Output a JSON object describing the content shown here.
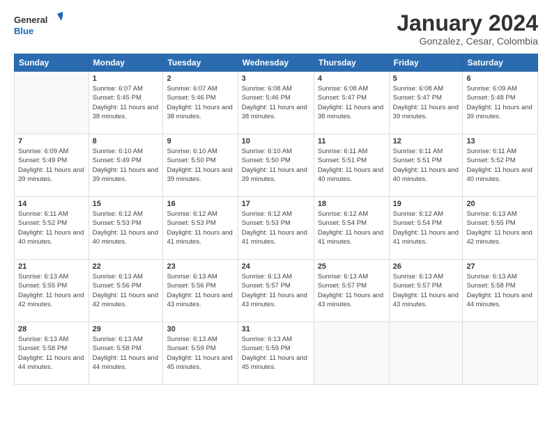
{
  "header": {
    "logo_line1": "General",
    "logo_line2": "Blue",
    "main_title": "January 2024",
    "subtitle": "Gonzalez, Cesar, Colombia"
  },
  "days_of_week": [
    "Sunday",
    "Monday",
    "Tuesday",
    "Wednesday",
    "Thursday",
    "Friday",
    "Saturday"
  ],
  "weeks": [
    [
      {
        "num": "",
        "sunrise": "",
        "sunset": "",
        "daylight": ""
      },
      {
        "num": "1",
        "sunrise": "Sunrise: 6:07 AM",
        "sunset": "Sunset: 5:45 PM",
        "daylight": "Daylight: 11 hours and 38 minutes."
      },
      {
        "num": "2",
        "sunrise": "Sunrise: 6:07 AM",
        "sunset": "Sunset: 5:46 PM",
        "daylight": "Daylight: 11 hours and 38 minutes."
      },
      {
        "num": "3",
        "sunrise": "Sunrise: 6:08 AM",
        "sunset": "Sunset: 5:46 PM",
        "daylight": "Daylight: 11 hours and 38 minutes."
      },
      {
        "num": "4",
        "sunrise": "Sunrise: 6:08 AM",
        "sunset": "Sunset: 5:47 PM",
        "daylight": "Daylight: 11 hours and 38 minutes."
      },
      {
        "num": "5",
        "sunrise": "Sunrise: 6:08 AM",
        "sunset": "Sunset: 5:47 PM",
        "daylight": "Daylight: 11 hours and 39 minutes."
      },
      {
        "num": "6",
        "sunrise": "Sunrise: 6:09 AM",
        "sunset": "Sunset: 5:48 PM",
        "daylight": "Daylight: 11 hours and 39 minutes."
      }
    ],
    [
      {
        "num": "7",
        "sunrise": "Sunrise: 6:09 AM",
        "sunset": "Sunset: 5:49 PM",
        "daylight": "Daylight: 11 hours and 39 minutes."
      },
      {
        "num": "8",
        "sunrise": "Sunrise: 6:10 AM",
        "sunset": "Sunset: 5:49 PM",
        "daylight": "Daylight: 11 hours and 39 minutes."
      },
      {
        "num": "9",
        "sunrise": "Sunrise: 6:10 AM",
        "sunset": "Sunset: 5:50 PM",
        "daylight": "Daylight: 11 hours and 39 minutes."
      },
      {
        "num": "10",
        "sunrise": "Sunrise: 6:10 AM",
        "sunset": "Sunset: 5:50 PM",
        "daylight": "Daylight: 11 hours and 39 minutes."
      },
      {
        "num": "11",
        "sunrise": "Sunrise: 6:11 AM",
        "sunset": "Sunset: 5:51 PM",
        "daylight": "Daylight: 11 hours and 40 minutes."
      },
      {
        "num": "12",
        "sunrise": "Sunrise: 6:11 AM",
        "sunset": "Sunset: 5:51 PM",
        "daylight": "Daylight: 11 hours and 40 minutes."
      },
      {
        "num": "13",
        "sunrise": "Sunrise: 6:11 AM",
        "sunset": "Sunset: 5:52 PM",
        "daylight": "Daylight: 11 hours and 40 minutes."
      }
    ],
    [
      {
        "num": "14",
        "sunrise": "Sunrise: 6:11 AM",
        "sunset": "Sunset: 5:52 PM",
        "daylight": "Daylight: 11 hours and 40 minutes."
      },
      {
        "num": "15",
        "sunrise": "Sunrise: 6:12 AM",
        "sunset": "Sunset: 5:53 PM",
        "daylight": "Daylight: 11 hours and 40 minutes."
      },
      {
        "num": "16",
        "sunrise": "Sunrise: 6:12 AM",
        "sunset": "Sunset: 5:53 PM",
        "daylight": "Daylight: 11 hours and 41 minutes."
      },
      {
        "num": "17",
        "sunrise": "Sunrise: 6:12 AM",
        "sunset": "Sunset: 5:53 PM",
        "daylight": "Daylight: 11 hours and 41 minutes."
      },
      {
        "num": "18",
        "sunrise": "Sunrise: 6:12 AM",
        "sunset": "Sunset: 5:54 PM",
        "daylight": "Daylight: 11 hours and 41 minutes."
      },
      {
        "num": "19",
        "sunrise": "Sunrise: 6:12 AM",
        "sunset": "Sunset: 5:54 PM",
        "daylight": "Daylight: 11 hours and 41 minutes."
      },
      {
        "num": "20",
        "sunrise": "Sunrise: 6:13 AM",
        "sunset": "Sunset: 5:55 PM",
        "daylight": "Daylight: 11 hours and 42 minutes."
      }
    ],
    [
      {
        "num": "21",
        "sunrise": "Sunrise: 6:13 AM",
        "sunset": "Sunset: 5:55 PM",
        "daylight": "Daylight: 11 hours and 42 minutes."
      },
      {
        "num": "22",
        "sunrise": "Sunrise: 6:13 AM",
        "sunset": "Sunset: 5:56 PM",
        "daylight": "Daylight: 11 hours and 42 minutes."
      },
      {
        "num": "23",
        "sunrise": "Sunrise: 6:13 AM",
        "sunset": "Sunset: 5:56 PM",
        "daylight": "Daylight: 11 hours and 43 minutes."
      },
      {
        "num": "24",
        "sunrise": "Sunrise: 6:13 AM",
        "sunset": "Sunset: 5:57 PM",
        "daylight": "Daylight: 11 hours and 43 minutes."
      },
      {
        "num": "25",
        "sunrise": "Sunrise: 6:13 AM",
        "sunset": "Sunset: 5:57 PM",
        "daylight": "Daylight: 11 hours and 43 minutes."
      },
      {
        "num": "26",
        "sunrise": "Sunrise: 6:13 AM",
        "sunset": "Sunset: 5:57 PM",
        "daylight": "Daylight: 11 hours and 43 minutes."
      },
      {
        "num": "27",
        "sunrise": "Sunrise: 6:13 AM",
        "sunset": "Sunset: 5:58 PM",
        "daylight": "Daylight: 11 hours and 44 minutes."
      }
    ],
    [
      {
        "num": "28",
        "sunrise": "Sunrise: 6:13 AM",
        "sunset": "Sunset: 5:58 PM",
        "daylight": "Daylight: 11 hours and 44 minutes."
      },
      {
        "num": "29",
        "sunrise": "Sunrise: 6:13 AM",
        "sunset": "Sunset: 5:58 PM",
        "daylight": "Daylight: 11 hours and 44 minutes."
      },
      {
        "num": "30",
        "sunrise": "Sunrise: 6:13 AM",
        "sunset": "Sunset: 5:59 PM",
        "daylight": "Daylight: 11 hours and 45 minutes."
      },
      {
        "num": "31",
        "sunrise": "Sunrise: 6:13 AM",
        "sunset": "Sunset: 5:59 PM",
        "daylight": "Daylight: 11 hours and 45 minutes."
      },
      {
        "num": "",
        "sunrise": "",
        "sunset": "",
        "daylight": ""
      },
      {
        "num": "",
        "sunrise": "",
        "sunset": "",
        "daylight": ""
      },
      {
        "num": "",
        "sunrise": "",
        "sunset": "",
        "daylight": ""
      }
    ]
  ]
}
